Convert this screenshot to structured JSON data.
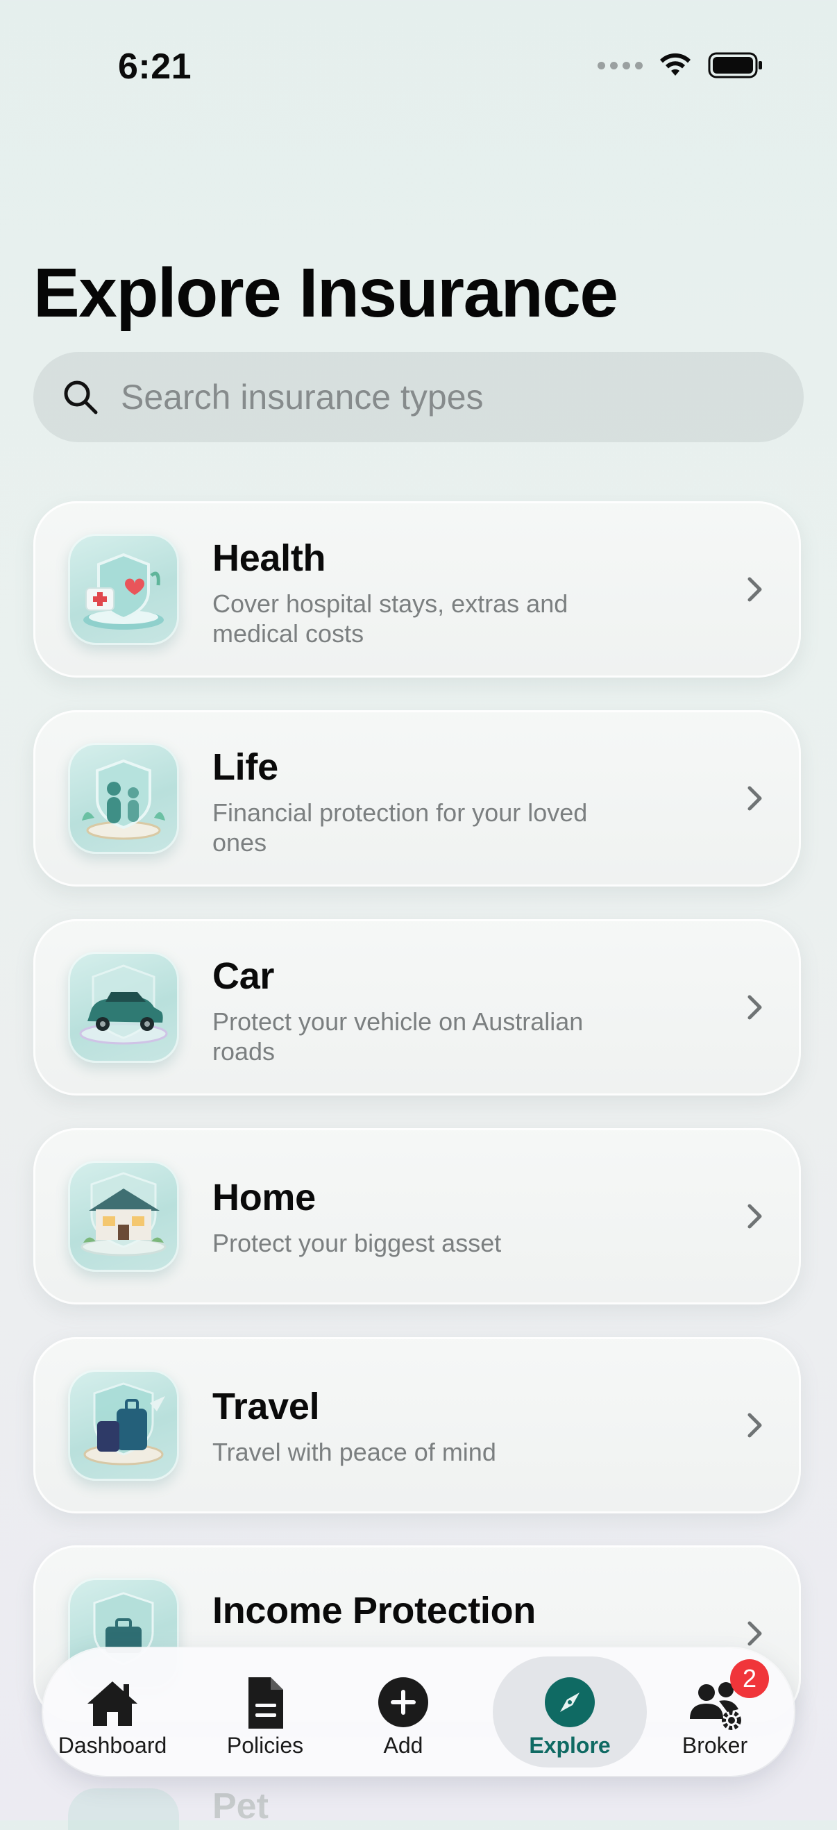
{
  "status_bar": {
    "time": "6:21"
  },
  "page": {
    "title": "Explore Insurance"
  },
  "search": {
    "placeholder": "Search insurance types",
    "value": ""
  },
  "insurance_types": [
    {
      "title": "Health",
      "description": "Cover hospital stays, extras and medical costs",
      "icon": "health-shield-icon"
    },
    {
      "title": "Life",
      "description": "Financial protection for your loved ones",
      "icon": "family-shield-icon"
    },
    {
      "title": "Car",
      "description": "Protect your vehicle on Australian roads",
      "icon": "car-icon"
    },
    {
      "title": "Home",
      "description": "Protect your biggest asset",
      "icon": "house-icon"
    },
    {
      "title": "Travel",
      "description": "Travel with peace of mind",
      "icon": "luggage-icon"
    },
    {
      "title": "Income Protection",
      "description": "",
      "icon": "briefcase-shield-icon"
    },
    {
      "title": "Pet",
      "description": "",
      "icon": "pet-icon"
    }
  ],
  "tab_bar": {
    "active": "Explore",
    "accent_color": "#0f6a63",
    "badge_color": "#f0353a",
    "tabs": [
      {
        "label": "Dashboard",
        "icon": "house-icon"
      },
      {
        "label": "Policies",
        "icon": "document-icon"
      },
      {
        "label": "Add",
        "icon": "plus-circle-icon"
      },
      {
        "label": "Explore",
        "icon": "compass-icon"
      },
      {
        "label": "Broker",
        "icon": "people-gear-icon",
        "badge": "2"
      }
    ]
  }
}
